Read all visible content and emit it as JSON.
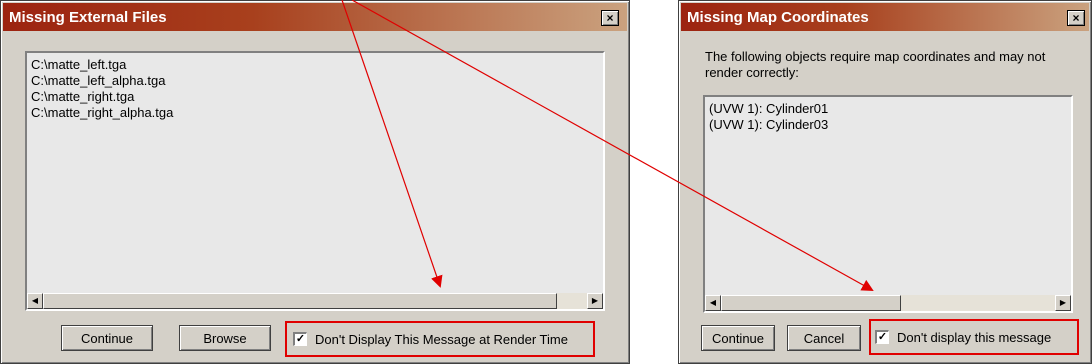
{
  "dialog1": {
    "title": "Missing External Files",
    "close_glyph": "×",
    "files": [
      "C:\\matte_left.tga",
      "C:\\matte_left_alpha.tga",
      "C:\\matte_right.tga",
      "C:\\matte_right_alpha.tga"
    ],
    "continue_label": "Continue",
    "browse_label": "Browse",
    "checkbox_label": "Don't Display This Message at Render Time",
    "checkbox_checked": true
  },
  "dialog2": {
    "title": "Missing Map Coordinates",
    "close_glyph": "×",
    "message": "The following objects require map coordinates and may not render correctly:",
    "objects": [
      "(UVW 1): Cylinder01",
      "(UVW 1): Cylinder03"
    ],
    "continue_label": "Continue",
    "cancel_label": "Cancel",
    "checkbox_label": "Don't display this message",
    "checkbox_checked": true
  },
  "check_glyph": "✓",
  "annotation": {
    "arrow_color": "#e00000",
    "highlight_color": "#e00000"
  },
  "icons": {
    "scroll_left": "scroll-left-arrow-icon",
    "scroll_right": "scroll-right-arrow-icon"
  }
}
